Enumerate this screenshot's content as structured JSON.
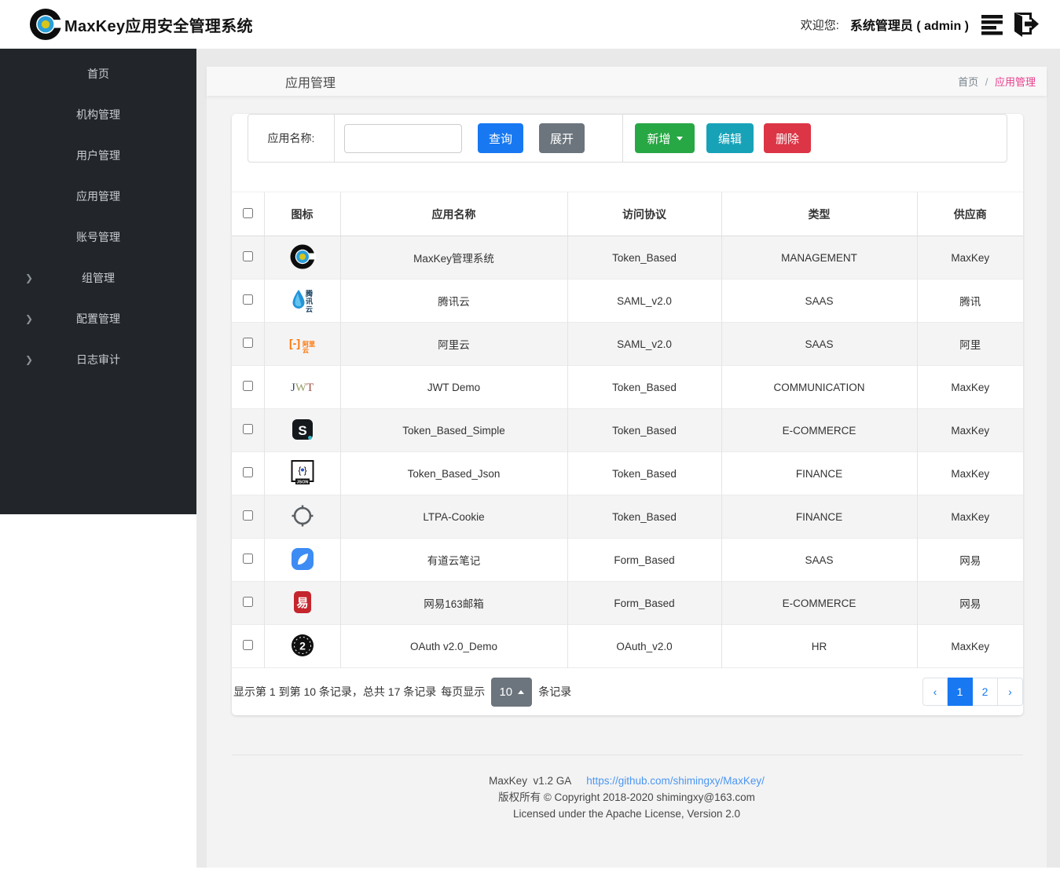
{
  "header": {
    "title": "MaxKey应用安全管理系统",
    "welcome_label": "欢迎您:",
    "user": "系统管理员 ( admin )"
  },
  "sidebar": {
    "items": [
      {
        "label": "首页",
        "expandable": false
      },
      {
        "label": "机构管理",
        "expandable": false
      },
      {
        "label": "用户管理",
        "expandable": false
      },
      {
        "label": "应用管理",
        "expandable": false
      },
      {
        "label": "账号管理",
        "expandable": false
      },
      {
        "label": "组管理",
        "expandable": true
      },
      {
        "label": "配置管理",
        "expandable": true
      },
      {
        "label": "日志审计",
        "expandable": true
      }
    ]
  },
  "page": {
    "title": "应用管理",
    "breadcrumb": {
      "home": "首页",
      "separator": "/",
      "current": "应用管理"
    }
  },
  "toolbar": {
    "search_label": "应用名称:",
    "search_value": "",
    "query_label": "查询",
    "expand_label": "展开",
    "add_label": "新增",
    "edit_label": "编辑",
    "delete_label": "删除"
  },
  "table": {
    "columns": [
      "图标",
      "应用名称",
      "访问协议",
      "类型",
      "供应商"
    ],
    "rows": [
      {
        "icon": "maxkey-icon",
        "name": "MaxKey管理系统",
        "protocol": "Token_Based",
        "category": "MANAGEMENT",
        "vendor": "MaxKey"
      },
      {
        "icon": "tencent-cloud-icon",
        "name": "腾讯云",
        "protocol": "SAML_v2.0",
        "category": "SAAS",
        "vendor": "腾讯"
      },
      {
        "icon": "aliyun-icon",
        "name": "阿里云",
        "protocol": "SAML_v2.0",
        "category": "SAAS",
        "vendor": "阿里"
      },
      {
        "icon": "jwt-icon",
        "name": "JWT Demo",
        "protocol": "Token_Based",
        "category": "COMMUNICATION",
        "vendor": "MaxKey"
      },
      {
        "icon": "simple-icon",
        "name": "Token_Based_Simple",
        "protocol": "Token_Based",
        "category": "E-COMMERCE",
        "vendor": "MaxKey"
      },
      {
        "icon": "json-icon",
        "name": "Token_Based_Json",
        "protocol": "Token_Based",
        "category": "FINANCE",
        "vendor": "MaxKey"
      },
      {
        "icon": "ltpa-icon",
        "name": "LTPA-Cookie",
        "protocol": "Token_Based",
        "category": "FINANCE",
        "vendor": "MaxKey"
      },
      {
        "icon": "youdao-icon",
        "name": "有道云笔记",
        "protocol": "Form_Based",
        "category": "SAAS",
        "vendor": "网易"
      },
      {
        "icon": "netease163-icon",
        "name": "网易163邮箱",
        "protocol": "Form_Based",
        "category": "E-COMMERCE",
        "vendor": "网易"
      },
      {
        "icon": "oauth2-icon",
        "name": "OAuth v2.0_Demo",
        "protocol": "OAuth_v2.0",
        "category": "HR",
        "vendor": "MaxKey"
      }
    ]
  },
  "pagination": {
    "summary": "显示第 1 到第 10 条记录，总共 17 条记录",
    "per_page_prefix": "每页显示",
    "per_page_value": "10",
    "per_page_suffix": "条记录",
    "prev": "‹",
    "next": "›",
    "pages": [
      "1",
      "2"
    ],
    "active_page": "1"
  },
  "footer": {
    "version": "MaxKey  v1.2 GA",
    "link": "https://github.com/shimingxy/MaxKey/",
    "copyright": "版权所有 © Copyright 2018-2020 shimingxy@163.com",
    "license": "Licensed under the Apache License, Version 2.0"
  },
  "colors": {
    "primary_blue": "#1778f2",
    "success_green": "#28a745",
    "info_teal": "#17a2b8",
    "danger_red": "#dc3545",
    "secondary_gray": "#6c757d",
    "breadcrumb_pink": "#e83e8c",
    "sidebar_bg": "#22262a",
    "link_blue": "#4b96f3"
  }
}
